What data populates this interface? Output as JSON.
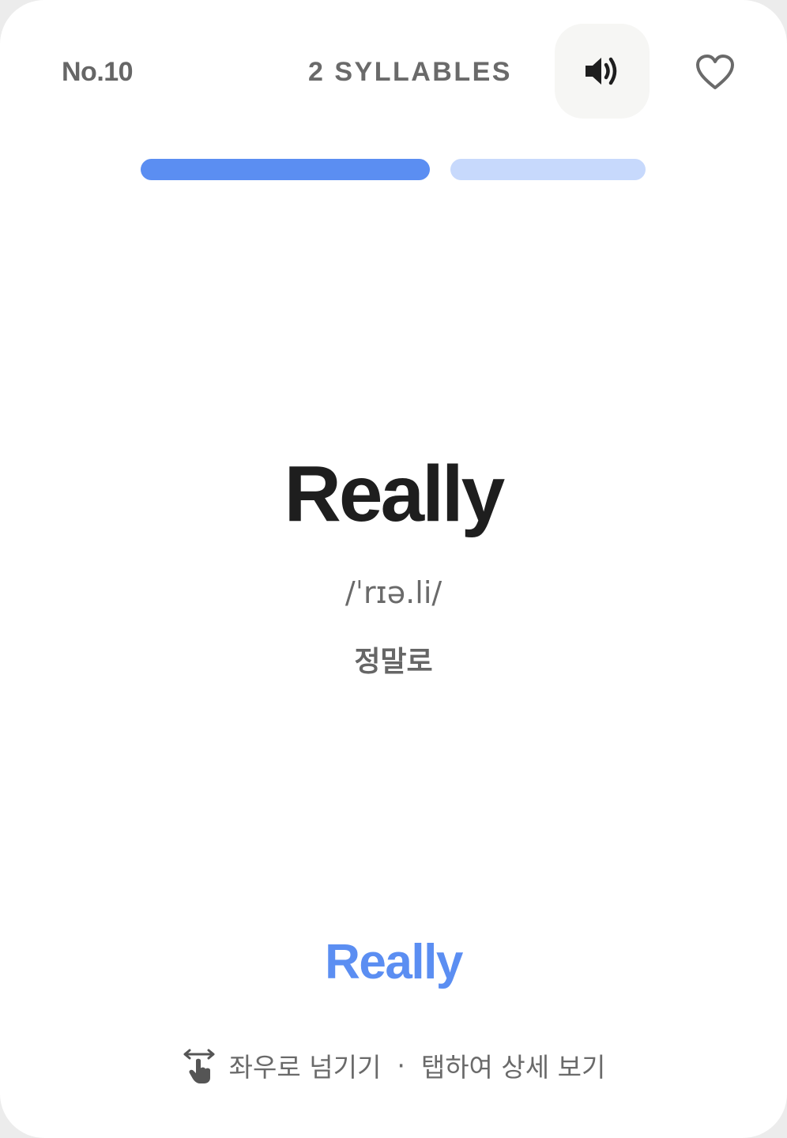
{
  "header": {
    "number": "No.10",
    "syllables": "2 SYLLABLES",
    "sound_icon": "speaker-volume-icon",
    "favorite_icon": "heart-outline-icon"
  },
  "progress": {
    "total_segments": 2,
    "current_segment": 1,
    "active_color": "#5b8ef2",
    "inactive_color": "#c7d9fc"
  },
  "card": {
    "word": "Really",
    "phonetic": "/ˈrɪə.li/",
    "meaning": "정말로",
    "answer": "Really"
  },
  "hint": {
    "icon": "swipe-tap-icon",
    "swipe_text": "좌우로 넘기기",
    "separator": "·",
    "tap_text": "탭하여 상세 보기"
  },
  "colors": {
    "accent": "#5b8ef2",
    "text_primary": "#1e1e1e",
    "text_secondary": "#6a6a6a"
  }
}
